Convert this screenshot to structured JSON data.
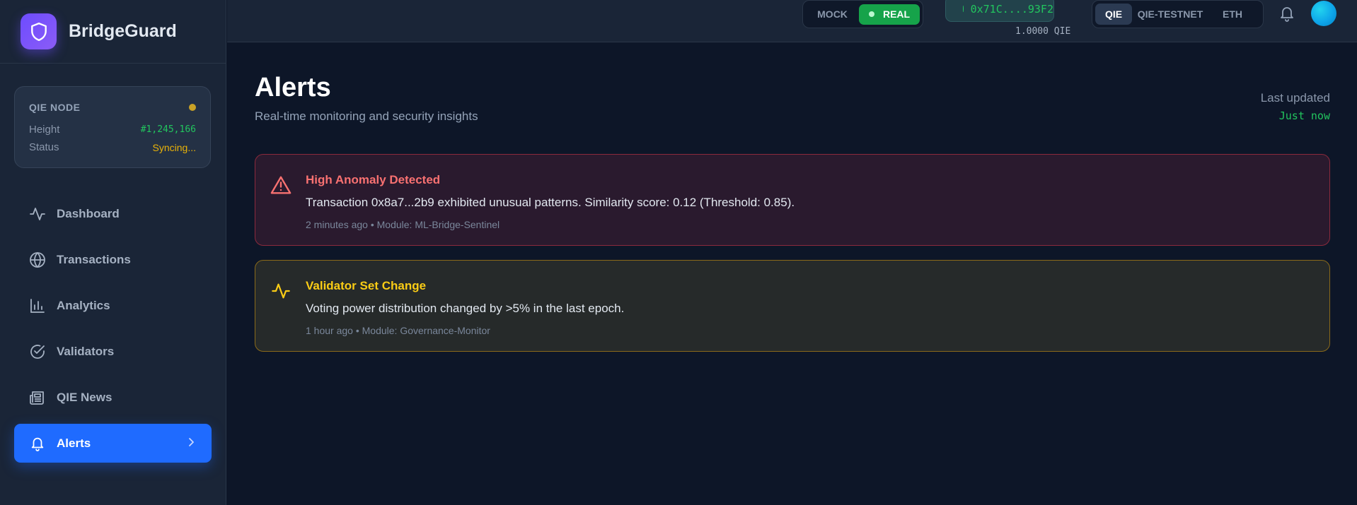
{
  "brand": {
    "name": "BridgeGuard",
    "logo_icon": "shield-icon"
  },
  "node": {
    "title": "QIE NODE",
    "indicator_color": "#c9a227",
    "height_label": "Height",
    "height_value": "#1,245,166",
    "status_label": "Status",
    "status_value": "Syncing..."
  },
  "sidebar": {
    "items": [
      {
        "label": "Dashboard",
        "icon": "activity-icon",
        "active": false
      },
      {
        "label": "Transactions",
        "icon": "globe-icon",
        "active": false
      },
      {
        "label": "Analytics",
        "icon": "bar-chart-icon",
        "active": false
      },
      {
        "label": "Validators",
        "icon": "check-circle-icon",
        "active": false
      },
      {
        "label": "QIE News",
        "icon": "newspaper-icon",
        "active": false
      },
      {
        "label": "Alerts",
        "icon": "bell-icon",
        "active": true
      }
    ]
  },
  "topbar": {
    "mode": {
      "mock_label": "MOCK",
      "real_label": "REAL",
      "selected": "REAL"
    },
    "wallet": {
      "address": "0x71C....93F2",
      "balance": "1.0000 QIE"
    },
    "networks": {
      "items": [
        "QIE",
        "QIE-TESTNET",
        "ETH"
      ],
      "selected": "QIE"
    }
  },
  "page": {
    "title": "Alerts",
    "subtitle": "Real-time monitoring and security insights",
    "updated_label": "Last updated",
    "updated_value": "Just now"
  },
  "alerts": [
    {
      "severity": "high",
      "icon": "warning-triangle-icon",
      "color": "#f87171",
      "title": "High Anomaly Detected",
      "body": "Transaction 0x8a7...2b9 exhibited unusual patterns. Similarity score: 0.12 (Threshold: 0.85).",
      "meta": "2 minutes ago • Module: ML-Bridge-Sentinel"
    },
    {
      "severity": "medium",
      "icon": "activity-icon",
      "color": "#facc15",
      "title": "Validator Set Change",
      "body": "Voting power distribution changed by >5% in the last epoch.",
      "meta": "1 hour ago • Module: Governance-Monitor"
    }
  ],
  "colors": {
    "accent": "#1f6bff",
    "success": "#22c55e",
    "warning": "#eab308",
    "danger": "#f87171"
  }
}
